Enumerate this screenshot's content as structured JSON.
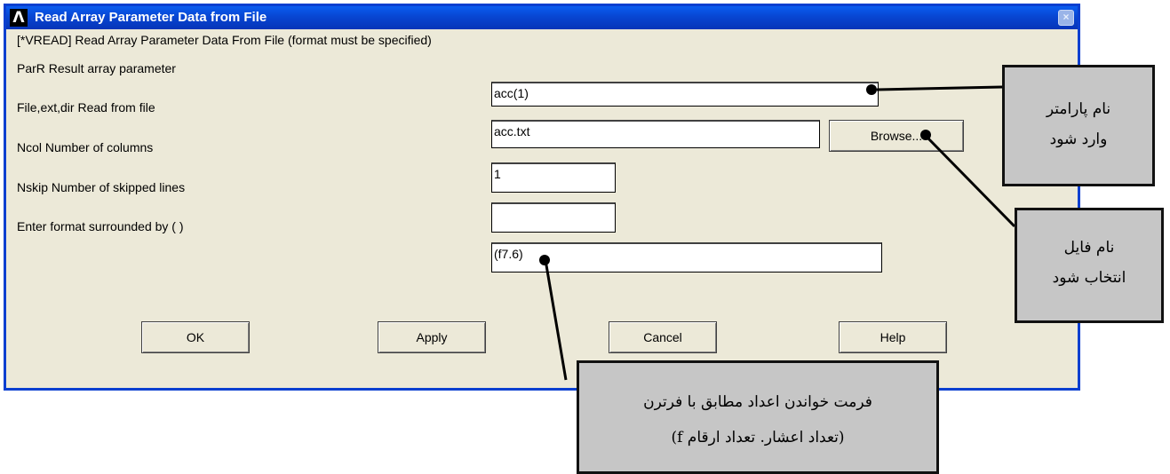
{
  "window": {
    "title": "Read Array Parameter Data from File",
    "icon": "ansys-logo-icon",
    "close_glyph": "×"
  },
  "header": "[*VREAD]  Read Array Parameter Data From File (format must be specified)",
  "fields": [
    {
      "label": "ParR   Result array parameter",
      "value": "acc(1)"
    },
    {
      "label": "File,ext,dir Read from file",
      "value": "acc.txt"
    },
    {
      "label": "Ncol Number of columns",
      "value": "1"
    },
    {
      "label": "Nskip  Number of skipped lines",
      "value": ""
    },
    {
      "label": "Enter format surrounded by ( )",
      "value": "(f7.6)"
    }
  ],
  "browse_label": "Browse...",
  "buttons": {
    "ok": "OK",
    "apply": "Apply",
    "cancel": "Cancel",
    "help": "Help"
  },
  "annotations": {
    "param_name": [
      "نام پارامتر",
      "وارد شود"
    ],
    "file_name": [
      "نام فایل",
      "انتخاب شود"
    ],
    "format": [
      "فرمت خواندن اعداد مطابق با فرترن",
      "(تعداد اعشار. تعداد ارقام f)"
    ]
  },
  "colors": {
    "titlebar": "#0a5df0",
    "dialog_bg": "#ece9d8",
    "note_bg": "#c6c6c6"
  }
}
